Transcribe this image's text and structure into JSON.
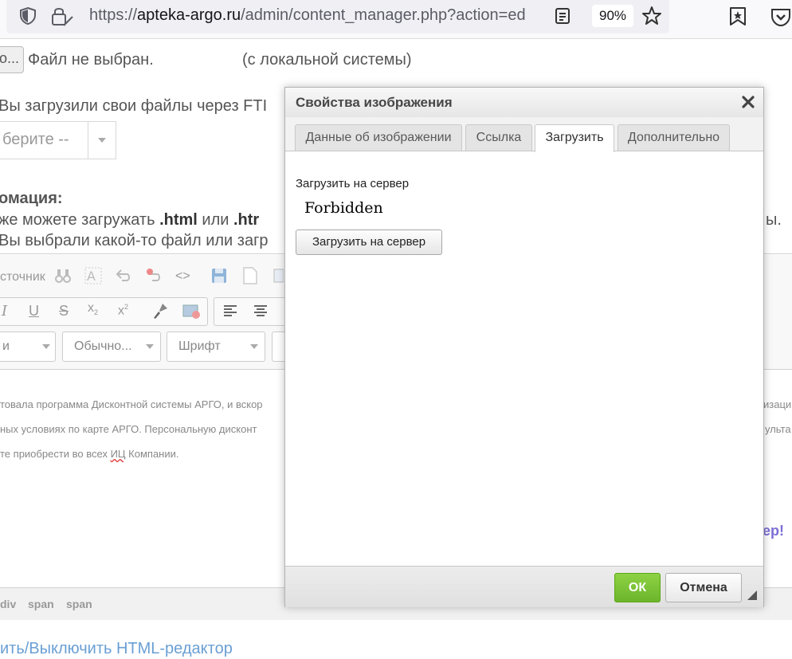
{
  "browser": {
    "url_prefix": "https://",
    "url_domain": "apteka-argo.ru",
    "url_path": "/admin/content_manager.php?action=ed",
    "zoom": "90%"
  },
  "page": {
    "file_status": "Файл не выбран.",
    "file_hint": "(с локальной системы)",
    "ftp_text": "Вы загрузили свои файлы через FTI",
    "select_text": "берите --",
    "info_heading": "омация:",
    "info_line1_a": "же можете загружать ",
    "info_line1_b": ".html",
    "info_line1_c": " или ",
    "info_line1_d": ".htr",
    "info_line1_tail": "ы.",
    "info_line2": "Вы выбрали какой-то файл или загр",
    "source_label": "сточник",
    "combo_styles": "и",
    "combo_format": "Обычно...",
    "combo_font": "Шрифт",
    "content_line1": "товала программа Дисконтной системы АРГО, и вскор",
    "content_line1_tail": "изаци",
    "content_line2": "ных условиях по карте АРГО. Персональную дисконт",
    "content_line2_tail": "ульта",
    "content_line3_a": "те приобрести во всех ",
    "content_line3_b": "ИЦ",
    "content_line3_c": " Компании.",
    "promo_tail": "ер!",
    "path_items": [
      "div",
      "span",
      "span"
    ],
    "toggle_html_link": "ить/Выключить HTML-редактор"
  },
  "dialog": {
    "title": "Свойства изображения",
    "tabs": [
      {
        "label": "Данные об изображении"
      },
      {
        "label": "Ссылка"
      },
      {
        "label": "Загрузить"
      },
      {
        "label": "Дополнительно"
      }
    ],
    "active_tab": "Загрузить",
    "upload_label": "Загрузить на сервер",
    "iframe_message": "Forbidden",
    "upload_button": "Загрузить на сервер",
    "ok_button": "ОК",
    "cancel_button": "Отмена"
  },
  "colors": {
    "ok_green": "#7cc13a",
    "link_blue": "#6a9fd4",
    "promo_purple": "#7b6fd6"
  }
}
